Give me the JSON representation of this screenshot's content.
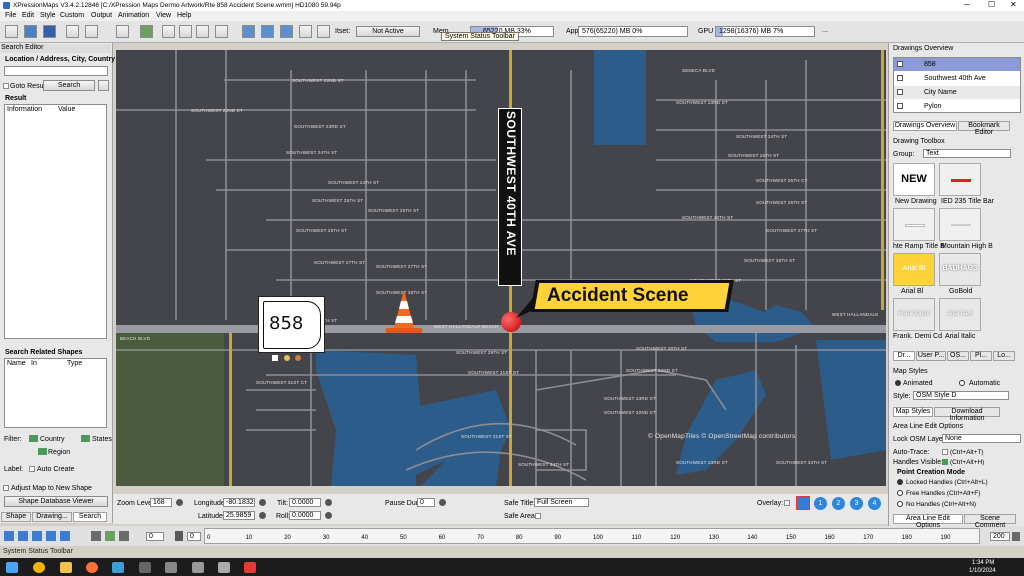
{
  "window": {
    "title": "XPressionMaps V3.4.2.12846 [C:/XPression Maps Dermo Artwork/Rte 858 Accident Scene.wmm] HD1080 59.94p"
  },
  "menu": [
    "File",
    "Edit",
    "Style",
    "Custom",
    "Output",
    "Animation",
    "View",
    "Help"
  ],
  "toolbar": {
    "itset_label": "Itset:",
    "itset_value": "Not Active",
    "mem_label": "Mem",
    "mem_value": "65220 MB 33%",
    "app_label": "App",
    "app_value": "576(65220) MB 0%",
    "gpu_label": "GPU",
    "gpu_value": "1298(16376) MB 7%",
    "more": "...",
    "tooltip": "System Status Toolbar"
  },
  "search_editor": {
    "title": "Search Editor",
    "location_label": "Location / Address, City, Country",
    "location_value": "",
    "goto_label": "Goto Result",
    "search_button": "Search",
    "result_label": "Result",
    "result_columns": [
      "Information",
      "Value"
    ],
    "related_label": "Search Related Shapes",
    "related_columns": [
      "Name",
      "In",
      "Type"
    ],
    "filter_label": "Filter:",
    "filter_country": "Country",
    "filter_states": "States",
    "filter_region": "Region",
    "label_label": "Label:",
    "auto_create": "Auto Create",
    "adjust_map": "Adjust Map to New Shape",
    "shape_db_button": "Shape Database Viewer",
    "tabs": [
      "Shape",
      "Drawing...",
      "Search"
    ]
  },
  "map": {
    "route_badge": "858",
    "accident_label": "Accident Scene",
    "vertical_street": "SOUTHWEST 40TH AVE",
    "attribution": "© OpenMapTiles © OpenStreetMap contributors",
    "hallandale": "WEST HALLANDALE BEACH",
    "hallandale_right": "WEST HALLANDALE",
    "beach_blvd": "BEACH BLVD",
    "seneca": "SENECA BLVD",
    "streets": [
      "SOUTHWEST 22ND ST",
      "SOUTHWEST 22ND ST",
      "SOUTHWEST 23RD ST",
      "SOUTHWEST 24TH ST",
      "SOUTHWEST 24TH ST",
      "SOUTHWEST 25TH ST",
      "SOUTHWEST 25TH ST",
      "SOUTHWEST 26TH ST",
      "SOUTHWEST 27TH ST",
      "SOUTHWEST 27TH ST",
      "SOUTHWEST 28TH ST",
      "SOUTHWEST 29TH ST",
      "SOUTHWEST 30TH ST",
      "SOUTHWEST 31ST CT",
      "SOUTHWEST 31ST ST",
      "SOUTHWEST 32ND ST",
      "SOUTHWEST 33RD ST",
      "SOUTHWEST 34TH ST",
      "SOUTHWEST 23RD ST",
      "SOUTHWEST 24TH ST",
      "SOUTHWEST 25TH ST",
      "SOUTHWEST 26TH ST",
      "SOUTHWEST 27TH ST",
      "SOUTHWEST 28TH ST",
      "SOUTHWEST 29TH ST",
      "SOUTHWEST 30TH ST",
      "SOUTHWEST 31ST ST",
      "SOUTHWEST 32ND ST",
      "SOUTHWEST 33RD ST",
      "SOUTHWEST 34TH ST",
      "SOUTHWEST 35TH ST",
      "SOUTHWEST 25TH CT"
    ]
  },
  "bottom_controls": {
    "zoom_label": "Zoom Level:",
    "zoom_value": "168",
    "lon_label": "Longitude:",
    "lon_value": "-80.1832",
    "lat_label": "Latitude:",
    "lat_value": "25.9859",
    "tilt_label": "Tilt:",
    "tilt_value": "0.0000",
    "roll_label": "Roll:",
    "roll_value": "0.0000",
    "pause_label": "Pause Dur.:",
    "pause_value": "0",
    "safe_title_label": "Safe Title:",
    "safe_title_value": "Full Screen",
    "safe_area_label": "Safe Area:",
    "overlay_label": "Overlay:",
    "bookmarks": [
      "1",
      "2",
      "3",
      "4"
    ]
  },
  "timeline": {
    "start": "0",
    "current": "0",
    "end": "200",
    "ticks": [
      "0",
      "10",
      "20",
      "30",
      "40",
      "50",
      "60",
      "70",
      "80",
      "90",
      "100",
      "110",
      "120",
      "130",
      "140",
      "150",
      "160",
      "170",
      "180",
      "190"
    ]
  },
  "status_bar": "System Status Toolbar",
  "right_panel": {
    "drawings_title": "Drawings Overview",
    "drawings": [
      "858",
      "Southwest 40th Ave",
      "City Name",
      "Pylon"
    ],
    "tabs_top": [
      "Drawings Overview",
      "Bookmark Editor"
    ],
    "toolbox_title": "Drawing Toolbox",
    "group_label": "Group:",
    "group_value": "Text",
    "tiles": [
      {
        "thumb": "NEW",
        "label": "New Drawing"
      },
      {
        "thumb": "",
        "label": "IED 235 Title Bar"
      },
      {
        "thumb": "",
        "label": "hte Ramp Title B"
      },
      {
        "thumb": "",
        "label": "Mountain High B"
      },
      {
        "thumb": "Arial Bl",
        "label": "Arial Bl"
      },
      {
        "thumb": "BAUHAUS",
        "label": "GoBold"
      },
      {
        "thumb": "Frank Demi",
        "label": "Frank. Demi Cd"
      },
      {
        "thumb": "Arial Italic",
        "label": "Arial Italic"
      }
    ],
    "tabs_mid": [
      "Dr...",
      "User P...",
      "OS...",
      "Pl...",
      "Lo..."
    ],
    "map_styles_title": "Map Styles",
    "animated": "Animated",
    "automatic": "Automatic",
    "style_label": "Style:",
    "style_value": "OSM Style D",
    "tabs_styles": [
      "Map Styles",
      "Download Information"
    ],
    "area_title": "Area Line Edit Options",
    "lock_label": "Lock OSM Layer:",
    "lock_value": "None",
    "autotrace_label": "Auto-Trace:",
    "autotrace_value": "(Ctrl+Alt+T)",
    "handles_label": "Handles Visible:",
    "handles_value": "(Ctrl+Alt+H)",
    "pcm_title": "Point Creation Mode",
    "modes": [
      "Locked Handles (Ctrl+Alt+L)",
      "Free Handles (Ctrl+Alt+F)",
      "No Handles (Ctrl+Alt+N)"
    ],
    "tabs_bottom": [
      "Area Line Edit Options",
      "Scene Comment"
    ]
  },
  "taskbar": {
    "time": "1:34 PM",
    "date": "1/10/2024"
  },
  "colors": {
    "map_bg": "#44444b",
    "water": "#2c5c8a",
    "road_yellow": "#caa638",
    "accent": "#ffd23a",
    "selected": "#8c9bd8"
  }
}
